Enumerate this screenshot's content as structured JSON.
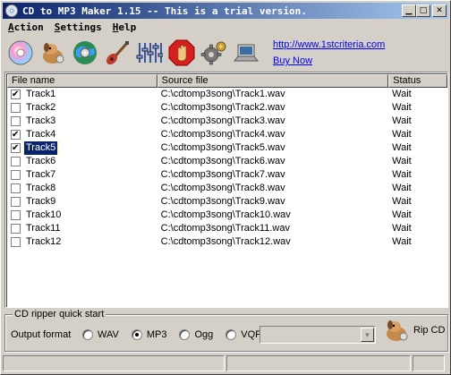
{
  "window": {
    "title": "CD to MP3 Maker 1.15 -- This is a trial version."
  },
  "menu": [
    {
      "label_first": "A",
      "label_rest": "ction"
    },
    {
      "label_first": "S",
      "label_rest": "ettings"
    },
    {
      "label_first": "H",
      "label_rest": "elp"
    }
  ],
  "toolbar": {
    "icons": [
      "cd-disc-icon",
      "dog-rip-icon",
      "globe-cd-icon",
      "guitar-icon",
      "equalizer-icon",
      "stop-hand-icon",
      "settings-gear-icon",
      "laptop-icon"
    ],
    "website_link": "http://www.1stcriteria.com",
    "buy_link": "Buy Now"
  },
  "table": {
    "columns": [
      "File name",
      "Source file",
      "Status"
    ],
    "rows": [
      {
        "name": "Track1",
        "source": "C:\\cdtomp3song\\Track1.wav",
        "status": "Wait",
        "checked": true
      },
      {
        "name": "Track2",
        "source": "C:\\cdtomp3song\\Track2.wav",
        "status": "Wait",
        "checked": false
      },
      {
        "name": "Track3",
        "source": "C:\\cdtomp3song\\Track3.wav",
        "status": "Wait",
        "checked": false
      },
      {
        "name": "Track4",
        "source": "C:\\cdtomp3song\\Track4.wav",
        "status": "Wait",
        "checked": true
      },
      {
        "name": "Track5",
        "source": "C:\\cdtomp3song\\Track5.wav",
        "status": "Wait",
        "checked": true,
        "selected": true
      },
      {
        "name": "Track6",
        "source": "C:\\cdtomp3song\\Track6.wav",
        "status": "Wait",
        "checked": false
      },
      {
        "name": "Track7",
        "source": "C:\\cdtomp3song\\Track7.wav",
        "status": "Wait",
        "checked": false
      },
      {
        "name": "Track8",
        "source": "C:\\cdtomp3song\\Track8.wav",
        "status": "Wait",
        "checked": false
      },
      {
        "name": "Track9",
        "source": "C:\\cdtomp3song\\Track9.wav",
        "status": "Wait",
        "checked": false
      },
      {
        "name": "Track10",
        "source": "C:\\cdtomp3song\\Track10.wav",
        "status": "Wait",
        "checked": false
      },
      {
        "name": "Track11",
        "source": "C:\\cdtomp3song\\Track11.wav",
        "status": "Wait",
        "checked": false
      },
      {
        "name": "Track12",
        "source": "C:\\cdtomp3song\\Track12.wav",
        "status": "Wait",
        "checked": false
      }
    ]
  },
  "quickstart": {
    "title": "CD ripper quick start",
    "output_label": "Output format",
    "formats": [
      {
        "label": "WAV",
        "selected": false
      },
      {
        "label": "MP3",
        "selected": true
      },
      {
        "label": "Ogg",
        "selected": false
      },
      {
        "label": "VQF",
        "selected": false
      }
    ],
    "quality_value": "",
    "rip_label": "Rip CD"
  },
  "colors": {
    "title_start": "#0a246a",
    "title_end": "#a6caf0",
    "selection": "#0a246a",
    "link": "#0000ff"
  }
}
